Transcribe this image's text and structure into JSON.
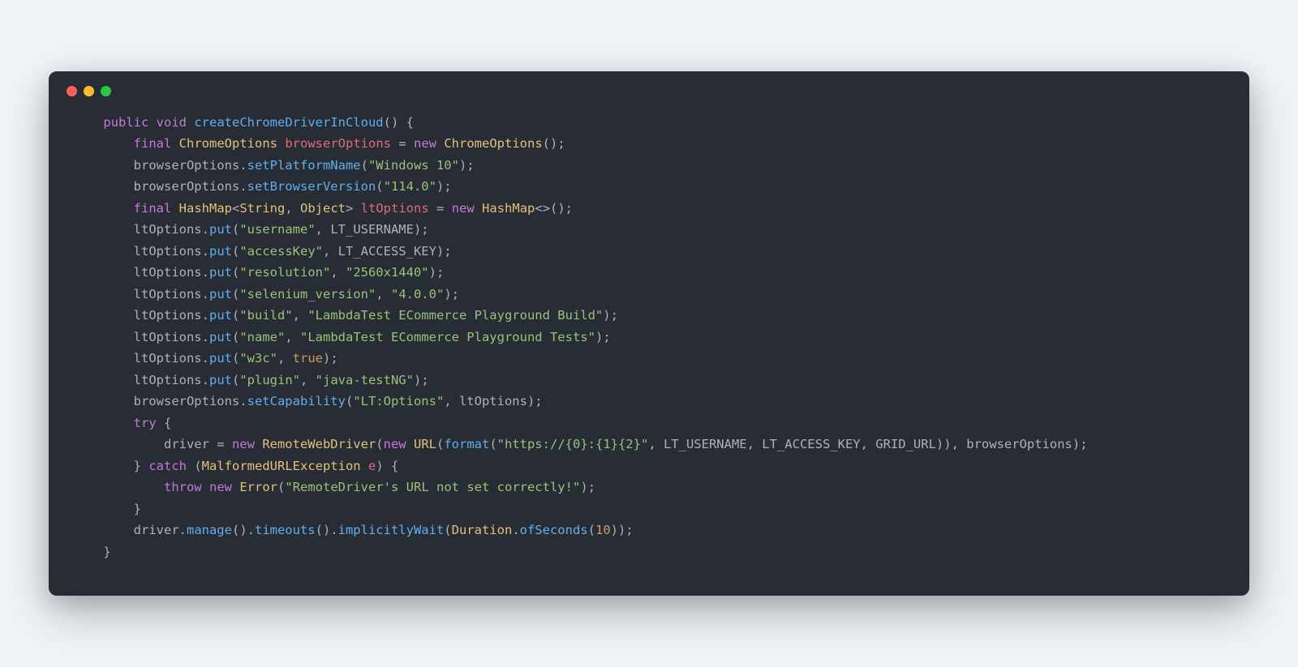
{
  "window": {
    "dots": {
      "red": "#ff5f57",
      "yellow": "#febc2e",
      "green": "#28c840"
    }
  },
  "code": {
    "tokens": [
      [
        {
          "c": "pln",
          "t": "    "
        },
        {
          "c": "kw",
          "t": "public"
        },
        {
          "c": "pln",
          "t": " "
        },
        {
          "c": "kw",
          "t": "void"
        },
        {
          "c": "pln",
          "t": " "
        },
        {
          "c": "fn",
          "t": "createChromeDriverInCloud"
        },
        {
          "c": "pln",
          "t": "() {"
        }
      ],
      [
        {
          "c": "pln",
          "t": "        "
        },
        {
          "c": "kw",
          "t": "final"
        },
        {
          "c": "pln",
          "t": " "
        },
        {
          "c": "type",
          "t": "ChromeOptions"
        },
        {
          "c": "pln",
          "t": " "
        },
        {
          "c": "var",
          "t": "browserOptions"
        },
        {
          "c": "pln",
          "t": " = "
        },
        {
          "c": "kw",
          "t": "new"
        },
        {
          "c": "pln",
          "t": " "
        },
        {
          "c": "type",
          "t": "ChromeOptions"
        },
        {
          "c": "pln",
          "t": "();"
        }
      ],
      [
        {
          "c": "pln",
          "t": "        browserOptions."
        },
        {
          "c": "fn",
          "t": "setPlatformName"
        },
        {
          "c": "pln",
          "t": "("
        },
        {
          "c": "str",
          "t": "\"Windows 10\""
        },
        {
          "c": "pln",
          "t": ");"
        }
      ],
      [
        {
          "c": "pln",
          "t": "        browserOptions."
        },
        {
          "c": "fn",
          "t": "setBrowserVersion"
        },
        {
          "c": "pln",
          "t": "("
        },
        {
          "c": "str",
          "t": "\"114.0\""
        },
        {
          "c": "pln",
          "t": ");"
        }
      ],
      [
        {
          "c": "pln",
          "t": "        "
        },
        {
          "c": "kw",
          "t": "final"
        },
        {
          "c": "pln",
          "t": " "
        },
        {
          "c": "type",
          "t": "HashMap"
        },
        {
          "c": "pln",
          "t": "<"
        },
        {
          "c": "type",
          "t": "String"
        },
        {
          "c": "pln",
          "t": ", "
        },
        {
          "c": "type",
          "t": "Object"
        },
        {
          "c": "pln",
          "t": "> "
        },
        {
          "c": "var",
          "t": "ltOptions"
        },
        {
          "c": "pln",
          "t": " = "
        },
        {
          "c": "kw",
          "t": "new"
        },
        {
          "c": "pln",
          "t": " "
        },
        {
          "c": "type",
          "t": "HashMap"
        },
        {
          "c": "pln",
          "t": "<>();"
        }
      ],
      [
        {
          "c": "pln",
          "t": "        ltOptions."
        },
        {
          "c": "fn",
          "t": "put"
        },
        {
          "c": "pln",
          "t": "("
        },
        {
          "c": "str",
          "t": "\"username\""
        },
        {
          "c": "pln",
          "t": ", LT_USERNAME);"
        }
      ],
      [
        {
          "c": "pln",
          "t": "        ltOptions."
        },
        {
          "c": "fn",
          "t": "put"
        },
        {
          "c": "pln",
          "t": "("
        },
        {
          "c": "str",
          "t": "\"accessKey\""
        },
        {
          "c": "pln",
          "t": ", LT_ACCESS_KEY);"
        }
      ],
      [
        {
          "c": "pln",
          "t": "        ltOptions."
        },
        {
          "c": "fn",
          "t": "put"
        },
        {
          "c": "pln",
          "t": "("
        },
        {
          "c": "str",
          "t": "\"resolution\""
        },
        {
          "c": "pln",
          "t": ", "
        },
        {
          "c": "str",
          "t": "\"2560x1440\""
        },
        {
          "c": "pln",
          "t": ");"
        }
      ],
      [
        {
          "c": "pln",
          "t": "        ltOptions."
        },
        {
          "c": "fn",
          "t": "put"
        },
        {
          "c": "pln",
          "t": "("
        },
        {
          "c": "str",
          "t": "\"selenium_version\""
        },
        {
          "c": "pln",
          "t": ", "
        },
        {
          "c": "str",
          "t": "\"4.0.0\""
        },
        {
          "c": "pln",
          "t": ");"
        }
      ],
      [
        {
          "c": "pln",
          "t": "        ltOptions."
        },
        {
          "c": "fn",
          "t": "put"
        },
        {
          "c": "pln",
          "t": "("
        },
        {
          "c": "str",
          "t": "\"build\""
        },
        {
          "c": "pln",
          "t": ", "
        },
        {
          "c": "str",
          "t": "\"LambdaTest ECommerce Playground Build\""
        },
        {
          "c": "pln",
          "t": ");"
        }
      ],
      [
        {
          "c": "pln",
          "t": "        ltOptions."
        },
        {
          "c": "fn",
          "t": "put"
        },
        {
          "c": "pln",
          "t": "("
        },
        {
          "c": "str",
          "t": "\"name\""
        },
        {
          "c": "pln",
          "t": ", "
        },
        {
          "c": "str",
          "t": "\"LambdaTest ECommerce Playground Tests\""
        },
        {
          "c": "pln",
          "t": ");"
        }
      ],
      [
        {
          "c": "pln",
          "t": "        ltOptions."
        },
        {
          "c": "fn",
          "t": "put"
        },
        {
          "c": "pln",
          "t": "("
        },
        {
          "c": "str",
          "t": "\"w3c\""
        },
        {
          "c": "pln",
          "t": ", "
        },
        {
          "c": "num",
          "t": "true"
        },
        {
          "c": "pln",
          "t": ");"
        }
      ],
      [
        {
          "c": "pln",
          "t": "        ltOptions."
        },
        {
          "c": "fn",
          "t": "put"
        },
        {
          "c": "pln",
          "t": "("
        },
        {
          "c": "str",
          "t": "\"plugin\""
        },
        {
          "c": "pln",
          "t": ", "
        },
        {
          "c": "str",
          "t": "\"java-testNG\""
        },
        {
          "c": "pln",
          "t": ");"
        }
      ],
      [
        {
          "c": "pln",
          "t": "        browserOptions."
        },
        {
          "c": "fn",
          "t": "setCapability"
        },
        {
          "c": "pln",
          "t": "("
        },
        {
          "c": "str",
          "t": "\"LT:Options\""
        },
        {
          "c": "pln",
          "t": ", ltOptions);"
        }
      ],
      [
        {
          "c": "pln",
          "t": "        "
        },
        {
          "c": "kw",
          "t": "try"
        },
        {
          "c": "pln",
          "t": " {"
        }
      ],
      [
        {
          "c": "pln",
          "t": "            driver = "
        },
        {
          "c": "kw",
          "t": "new"
        },
        {
          "c": "pln",
          "t": " "
        },
        {
          "c": "type",
          "t": "RemoteWebDriver"
        },
        {
          "c": "pln",
          "t": "("
        },
        {
          "c": "kw",
          "t": "new"
        },
        {
          "c": "pln",
          "t": " "
        },
        {
          "c": "type",
          "t": "URL"
        },
        {
          "c": "pln",
          "t": "("
        },
        {
          "c": "fn",
          "t": "format"
        },
        {
          "c": "pln",
          "t": "("
        },
        {
          "c": "str",
          "t": "\"https://{0}:{1}{2}\""
        },
        {
          "c": "pln",
          "t": ", LT_USERNAME, LT_ACCESS_KEY, GRID_URL)), browserOptions);"
        }
      ],
      [
        {
          "c": "pln",
          "t": "        } "
        },
        {
          "c": "kw",
          "t": "catch"
        },
        {
          "c": "pln",
          "t": " ("
        },
        {
          "c": "type",
          "t": "MalformedURLException"
        },
        {
          "c": "pln",
          "t": " "
        },
        {
          "c": "var",
          "t": "e"
        },
        {
          "c": "pln",
          "t": ") {"
        }
      ],
      [
        {
          "c": "pln",
          "t": "            "
        },
        {
          "c": "kw",
          "t": "throw"
        },
        {
          "c": "pln",
          "t": " "
        },
        {
          "c": "kw",
          "t": "new"
        },
        {
          "c": "pln",
          "t": " "
        },
        {
          "c": "type",
          "t": "Error"
        },
        {
          "c": "pln",
          "t": "("
        },
        {
          "c": "str",
          "t": "\"RemoteDriver's URL not set correctly!\""
        },
        {
          "c": "pln",
          "t": ");"
        }
      ],
      [
        {
          "c": "pln",
          "t": "        }"
        }
      ],
      [
        {
          "c": "pln",
          "t": "        driver."
        },
        {
          "c": "fn",
          "t": "manage"
        },
        {
          "c": "pln",
          "t": "()."
        },
        {
          "c": "fn",
          "t": "timeouts"
        },
        {
          "c": "pln",
          "t": "()."
        },
        {
          "c": "fn",
          "t": "implicitlyWait"
        },
        {
          "c": "pln",
          "t": "("
        },
        {
          "c": "type",
          "t": "Duration"
        },
        {
          "c": "pln",
          "t": "."
        },
        {
          "c": "fn",
          "t": "ofSeconds"
        },
        {
          "c": "pln",
          "t": "("
        },
        {
          "c": "num",
          "t": "10"
        },
        {
          "c": "pln",
          "t": "));"
        }
      ],
      [
        {
          "c": "pln",
          "t": "    }"
        }
      ]
    ]
  }
}
